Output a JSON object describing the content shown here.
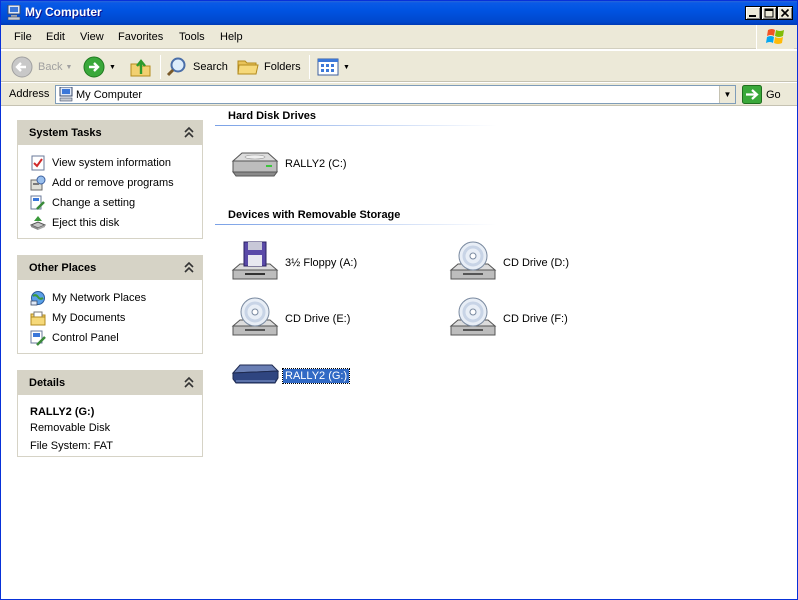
{
  "window": {
    "title": "My Computer",
    "icon": "computer-icon"
  },
  "menu": [
    "File",
    "Edit",
    "View",
    "Favorites",
    "Tools",
    "Help"
  ],
  "toolbar": {
    "back_label": "Back",
    "search_label": "Search",
    "folders_label": "Folders"
  },
  "address": {
    "label": "Address",
    "value": "My Computer",
    "go_label": "Go"
  },
  "system_tasks": {
    "title": "System Tasks",
    "items": [
      {
        "label": "View system information",
        "icon": "system-info-icon"
      },
      {
        "label": "Add or remove programs",
        "icon": "add-remove-programs-icon"
      },
      {
        "label": "Change a setting",
        "icon": "change-setting-icon"
      },
      {
        "label": "Eject this disk",
        "icon": "eject-icon"
      }
    ]
  },
  "other_places": {
    "title": "Other Places",
    "items": [
      {
        "label": "My Network Places",
        "icon": "network-places-icon"
      },
      {
        "label": "My Documents",
        "icon": "my-documents-icon"
      },
      {
        "label": "Control Panel",
        "icon": "control-panel-icon"
      }
    ]
  },
  "details": {
    "title": "Details",
    "name": "RALLY2 (G:)",
    "type": "Removable Disk",
    "filesystem": "File System: FAT"
  },
  "groups": {
    "hard_disks": {
      "title": "Hard Disk Drives",
      "drives": [
        {
          "label": "RALLY2 (C:)",
          "icon": "hard-disk-icon"
        }
      ]
    },
    "removable": {
      "title": "Devices with Removable Storage",
      "drives": [
        {
          "label": "3½ Floppy (A:)",
          "icon": "floppy-drive-icon"
        },
        {
          "label": "CD Drive (D:)",
          "icon": "cd-drive-icon"
        },
        {
          "label": "CD Drive (E:)",
          "icon": "cd-drive-icon"
        },
        {
          "label": "CD Drive (F:)",
          "icon": "cd-drive-icon"
        },
        {
          "label": "RALLY2 (G:)",
          "icon": "removable-disk-icon",
          "selected": true
        }
      ]
    }
  },
  "colors": {
    "titlebar": "#0053e1",
    "selection": "#316ac5",
    "panel_header": "#d6d3c6"
  }
}
